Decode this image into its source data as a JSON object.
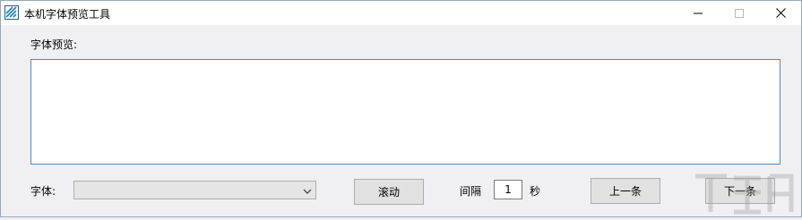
{
  "window": {
    "title": "本机字体预览工具",
    "icon": "app-logo-icon",
    "controls": {
      "minimize_icon": "minimize-icon",
      "maximize_icon": "maximize-icon",
      "close_icon": "close-icon"
    }
  },
  "preview": {
    "label": "字体预览:",
    "text": ""
  },
  "font": {
    "label": "字体:",
    "selected": ""
  },
  "buttons": {
    "scroll": "滚动",
    "prev": "上一条",
    "next": "下一条"
  },
  "interval": {
    "label": "间隔",
    "value": "1",
    "unit": "秒"
  },
  "colors": {
    "accent_border": "#4a8ac6",
    "window_bg": "#f0eff2",
    "button_bg": "#e1e1e1"
  }
}
